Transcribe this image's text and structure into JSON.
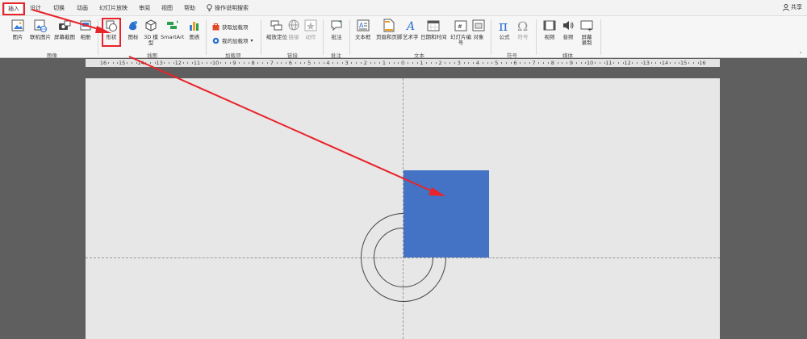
{
  "menu": {
    "tabs": [
      {
        "label": "插入"
      },
      {
        "label": "设计"
      },
      {
        "label": "切换"
      },
      {
        "label": "动画"
      },
      {
        "label": "幻灯片放映"
      },
      {
        "label": "审阅"
      },
      {
        "label": "视图"
      },
      {
        "label": "帮助"
      }
    ],
    "tell_me": "操作说明搜索",
    "share": "共享"
  },
  "ribbon": {
    "images": {
      "picture": "图片",
      "online_picture": "联机图片",
      "screenshot": "屏幕截图",
      "album": "相册",
      "group": "图像"
    },
    "illustrations": {
      "shapes": "形状",
      "icons": "图标",
      "model_3d": "3D 模型",
      "smartart": "SmartArt",
      "chart": "图表",
      "group": "插图"
    },
    "addins": {
      "get": "获取加载项",
      "mine": "我的加载项",
      "group": "加载项"
    },
    "links": {
      "zoom": "缩放定位",
      "link": "链接",
      "action": "动作",
      "group": "链接"
    },
    "comments": {
      "comment": "批注",
      "group": "批注"
    },
    "text": {
      "textbox": "文本框",
      "header_footer": "页眉和页脚",
      "wordart": "艺术字",
      "datetime": "日期和时间",
      "slide_number": "幻灯片编号",
      "object": "对象",
      "group": "文本"
    },
    "symbols": {
      "equation": "公式",
      "symbol": "符号",
      "group": "符号"
    },
    "media": {
      "video": "视频",
      "audio": "音频",
      "screen_recording": "屏幕录制",
      "group": "媒体"
    }
  },
  "ruler": {
    "ticks": [
      "16",
      "15",
      "14",
      "13",
      "12",
      "11",
      "10",
      "9",
      "8",
      "7",
      "6",
      "5",
      "4",
      "3",
      "2",
      "1",
      "0",
      "1",
      "2",
      "3",
      "4",
      "5",
      "6",
      "7",
      "8",
      "9",
      "10",
      "11",
      "12",
      "13",
      "14",
      "15",
      "16"
    ]
  },
  "colors": {
    "accent_red": "#e8232a",
    "shape_fill": "#4472c4"
  }
}
